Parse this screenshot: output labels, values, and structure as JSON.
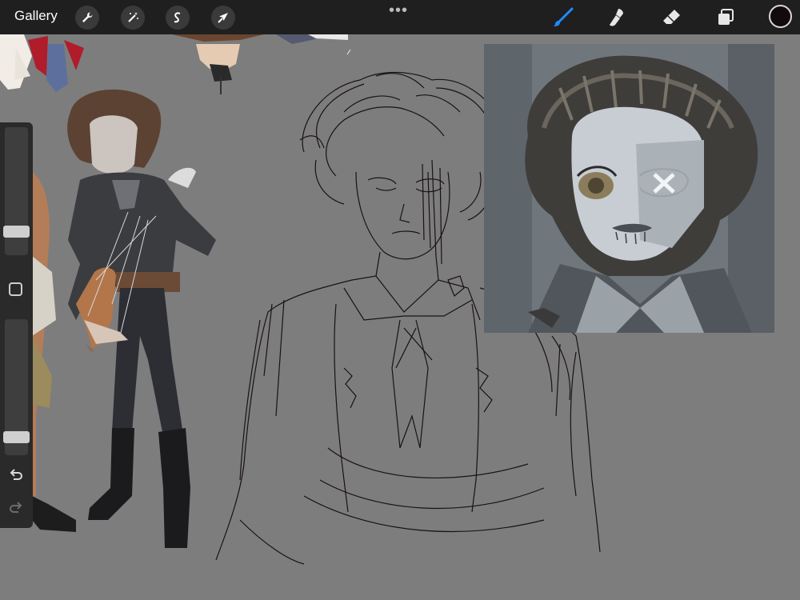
{
  "topbar": {
    "gallery_label": "Gallery",
    "left_tools": [
      "wrench-icon",
      "magic-wand-icon",
      "selection-icon",
      "transform-arrow-icon"
    ],
    "more_dots": "•••",
    "right_tools": [
      "brush-icon",
      "smudge-icon",
      "eraser-icon",
      "layers-icon"
    ],
    "active_tool": "brush-icon",
    "active_color": "#120a0c",
    "accent_color": "#1f8bff"
  },
  "sidebar": {
    "brush_size": 0.15,
    "opacity": 0.1,
    "undo_icon": "undo-arrow-icon",
    "redo_icon": "redo-arrow-icon"
  }
}
